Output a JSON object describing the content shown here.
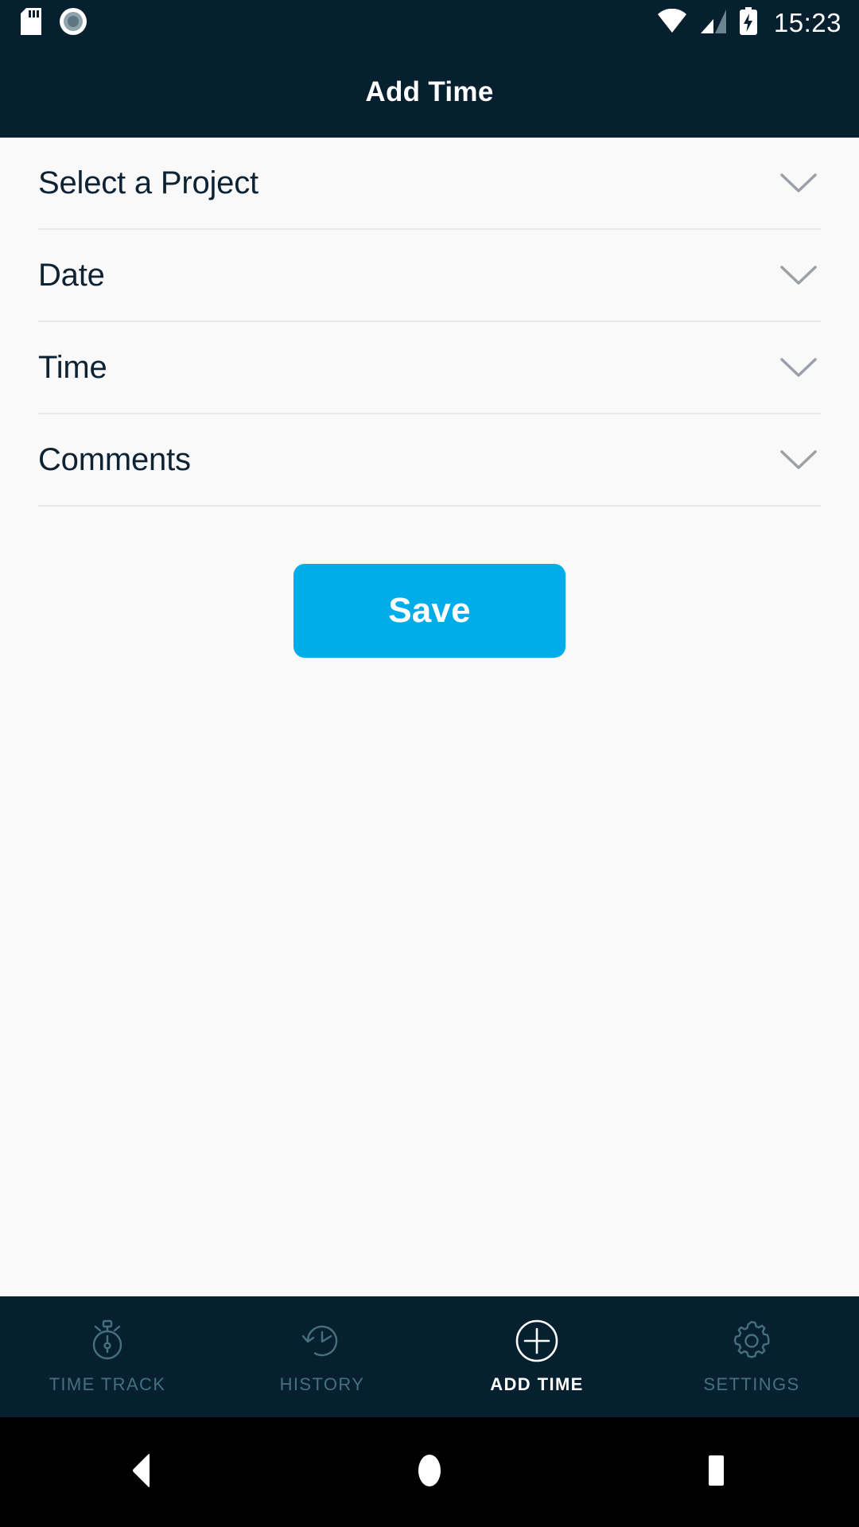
{
  "status_bar": {
    "left_icons": [
      "sd-card-icon",
      "screen-record-icon"
    ],
    "right_icons": [
      "wifi-icon",
      "cellular-signal-icon",
      "battery-charging-icon"
    ],
    "time": "15:23"
  },
  "header": {
    "title": "Add Time",
    "background": "#06202f"
  },
  "form": {
    "rows": [
      {
        "label": "Select a Project",
        "icon": "chevron-down-icon"
      },
      {
        "label": "Date",
        "icon": "chevron-down-icon"
      },
      {
        "label": "Time",
        "icon": "chevron-down-icon"
      },
      {
        "label": "Comments",
        "icon": "chevron-down-icon"
      }
    ],
    "save_button": {
      "label": "Save",
      "background": "#00ade8",
      "text_color": "#ffffff"
    }
  },
  "tab_bar": {
    "background": "#06202f",
    "active_color": "#ffffff",
    "inactive_color": "#46707f",
    "tabs": [
      {
        "label": "TIME TRACK",
        "icon": "stopwatch-icon",
        "active": false
      },
      {
        "label": "HISTORY",
        "icon": "history-clock-icon",
        "active": false
      },
      {
        "label": "ADD TIME",
        "icon": "plus-circle-icon",
        "active": true
      },
      {
        "label": "SETTINGS",
        "icon": "gear-icon",
        "active": false
      }
    ]
  },
  "android_nav": {
    "background": "#000000",
    "buttons": [
      "back-icon",
      "home-icon",
      "recents-icon"
    ]
  }
}
